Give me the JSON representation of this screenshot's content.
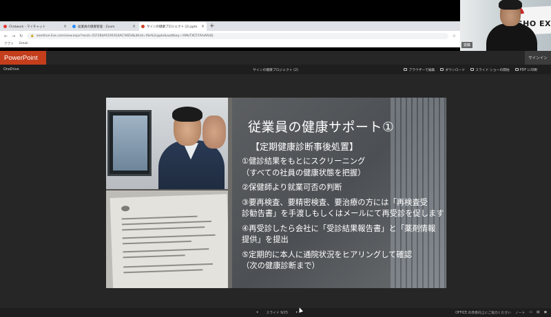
{
  "browser": {
    "tabs": [
      {
        "label": "Chatwork - マイチャット",
        "color": "#e53935",
        "active": false
      },
      {
        "label": "従業員の健康管理 - Zoom",
        "color": "#2d8cff",
        "active": false
      },
      {
        "label": "サインの健康プロジェクト (2).pptx",
        "color": "#d04423",
        "active": true
      }
    ],
    "new_tab_glyph": "+",
    "close_glyph": "×",
    "url": "onedrive.live.com/view.aspx?resid=51F264A5191914AC!6654&ithint=file%2cpptx&authkey=!AMvTXC57AhiARdQ",
    "bookmarks": [
      "アプリ",
      "Gmail"
    ]
  },
  "webcam": {
    "name": "齋藤",
    "sign_text": "SHO EX"
  },
  "app": {
    "brand": "PowerPoint",
    "signin": "サインイン",
    "onedrive": "OneDrive",
    "document_title": "サインの健康プロジェクト (2)",
    "actions": [
      "ブラウザーで編集",
      "ダウンロード",
      "スライド ショーの開始",
      "PDF に印刷"
    ]
  },
  "slide": {
    "title": "従業員の健康サポート①",
    "subtitle": "【定期健康診断事後処置】",
    "bullets": [
      "①健診結果をもとにスクリーニング",
      "（すべての社員の健康状態を把握）",
      "②保健師より就業可否の判断",
      "③要再検査、要精密検査、要治療の方には「再検査受",
      "診勧告書」を手渡しもしくはメールにて再受診を促します",
      "④再受診したら会社に「受診結果報告書」と「薬剤情報",
      "提供」を提出",
      "⑤定期的に本人に通院状況をヒアリングして確認",
      "（次の健康診断まで）"
    ]
  },
  "statusbar": {
    "prev": "◂",
    "counter": "スライド 9/25",
    "next": "▸",
    "help": "OFFICE の改善向上にご協力ください",
    "notes": "ノート"
  }
}
